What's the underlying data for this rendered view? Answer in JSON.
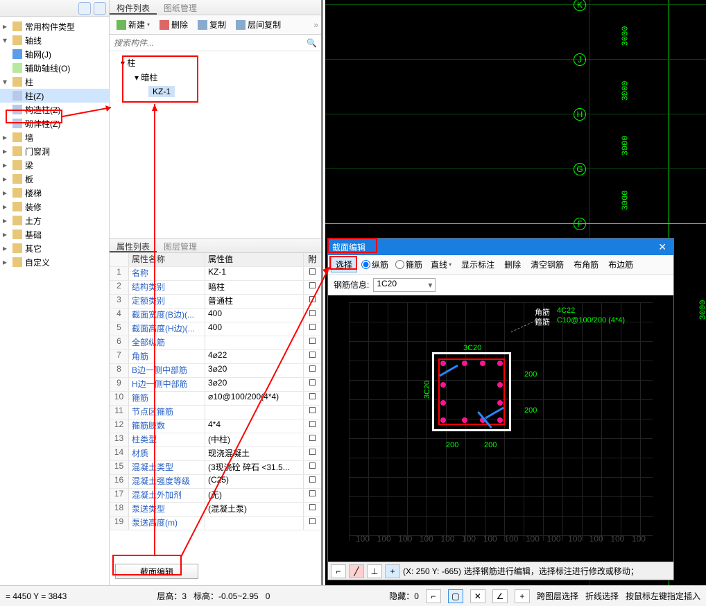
{
  "left_tree": {
    "common_types": "常用构件类型",
    "axis": "轴线",
    "axis_grid": "轴网(J)",
    "aux_axis": "辅助轴线(O)",
    "column": "柱",
    "column_z": "柱(Z)",
    "struct_col": "构造柱(Z)",
    "masonry_col": "砌体柱(Z)",
    "wall": "墙",
    "opening": "门窗洞",
    "beam": "梁",
    "slab": "板",
    "stair": "楼梯",
    "decoration": "装修",
    "earth": "土方",
    "foundation": "基础",
    "other": "其它",
    "custom": "自定义"
  },
  "mid": {
    "tab_list": "构件列表",
    "tab_drawing": "图纸管理",
    "new_btn": "新建",
    "delete_btn": "删除",
    "copy_btn": "复制",
    "floor_copy_btn": "层间复制",
    "search_placeholder": "搜索构件...",
    "tree_l1": "柱",
    "tree_l2": "暗柱",
    "tree_l3": "KZ-1"
  },
  "prop": {
    "tab_list": "属性列表",
    "tab_layer": "图层管理",
    "col_name": "属性名称",
    "col_val": "属性值",
    "col_att": "附",
    "rows": [
      [
        "1",
        "名称",
        "KZ-1"
      ],
      [
        "2",
        "结构类别",
        "暗柱"
      ],
      [
        "3",
        "定额类别",
        "普通柱"
      ],
      [
        "4",
        "截面宽度(B边)(...",
        "400"
      ],
      [
        "5",
        "截面高度(H边)(...",
        "400"
      ],
      [
        "6",
        "全部纵筋",
        ""
      ],
      [
        "7",
        "角筋",
        "4⌀22"
      ],
      [
        "8",
        "B边一侧中部筋",
        "3⌀20"
      ],
      [
        "9",
        "H边一侧中部筋",
        "3⌀20"
      ],
      [
        "10",
        "箍筋",
        "⌀10@100/200(4*4)"
      ],
      [
        "11",
        "节点区箍筋",
        ""
      ],
      [
        "12",
        "箍筋肢数",
        "4*4"
      ],
      [
        "13",
        "柱类型",
        "(中柱)"
      ],
      [
        "14",
        "材质",
        "现浇混凝土"
      ],
      [
        "15",
        "混凝土类型",
        "(3现浇砼 碎石 <31.5..."
      ],
      [
        "16",
        "混凝土强度等级",
        "(C25)"
      ],
      [
        "17",
        "混凝土外加剂",
        "(无)"
      ],
      [
        "18",
        "泵送类型",
        "(混凝土泵)"
      ],
      [
        "19",
        "泵送高度(m)",
        ""
      ]
    ],
    "section_edit": "截面编辑"
  },
  "dialog": {
    "title": "截面编辑",
    "select_btn": "选择",
    "radio_long": "纵筋",
    "radio_stirrup": "箍筋",
    "line_btn": "直线",
    "show_dim": "显示标注",
    "delete": "删除",
    "clear_rebar": "清空钢筋",
    "dist_corner": "布角筋",
    "dist_edge": "布边筋",
    "rebar_info": "钢筋信息:",
    "rebar_val": "1C20",
    "corner_note": "角筋",
    "stirrup_note": "箍筋",
    "rebar_4c22": "4C22",
    "rebar_c10": "C10@100/200 (4*4)",
    "top_3c20": "3C20",
    "side_3c20": "3C20",
    "dim_200": "200",
    "status_coord": "(X: 250 Y: -665)",
    "status_hint": "选择钢筋进行编辑，选择标注进行修改或移动；"
  },
  "status": {
    "coord": "= 4450 Y = 3843",
    "floor": "层高：3",
    "elev": "标高：-0.05~2.95",
    "zero": "0",
    "hidden": "隐藏：0",
    "cross_select": "跨图层选择",
    "fold_select": "折线选择",
    "hint": "按鼠标左键指定插入"
  },
  "cad": {
    "labels": [
      "K",
      "J",
      "H",
      "G",
      "F"
    ],
    "dim_3000": "3000"
  }
}
